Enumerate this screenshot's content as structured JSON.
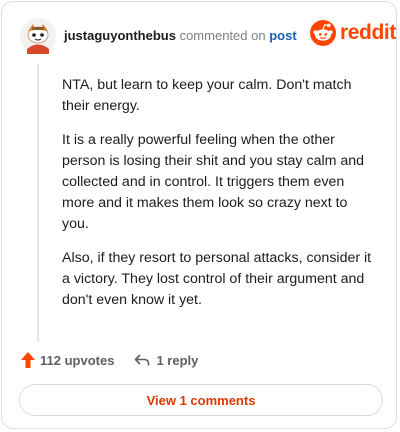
{
  "header": {
    "username": "justaguyonthebus",
    "action": "commented on",
    "post_link": "post",
    "brand": "reddit"
  },
  "comment": {
    "paragraphs": [
      "NTA, but learn to keep your calm. Don't match their energy.",
      "It is a really powerful feeling when the other person is losing their shit and you stay calm and collected and in control. It triggers them even more and it makes them look so crazy next to you.",
      "Also, if they resort to personal attacks, consider it a victory. They lost control of their argument and don't even know it yet."
    ]
  },
  "footer": {
    "upvotes": "112 upvotes",
    "replies": "1 reply"
  },
  "view_comments": "View 1 comments",
  "colors": {
    "brand": "#ff4500",
    "link": "#1a5fb4",
    "view_button_text": "#d93a00"
  },
  "icons": {
    "avatar": "snoo-avatar-icon",
    "logo": "reddit-snoo-icon",
    "upvote": "upvote-arrow-icon",
    "reply": "reply-arrow-icon"
  }
}
